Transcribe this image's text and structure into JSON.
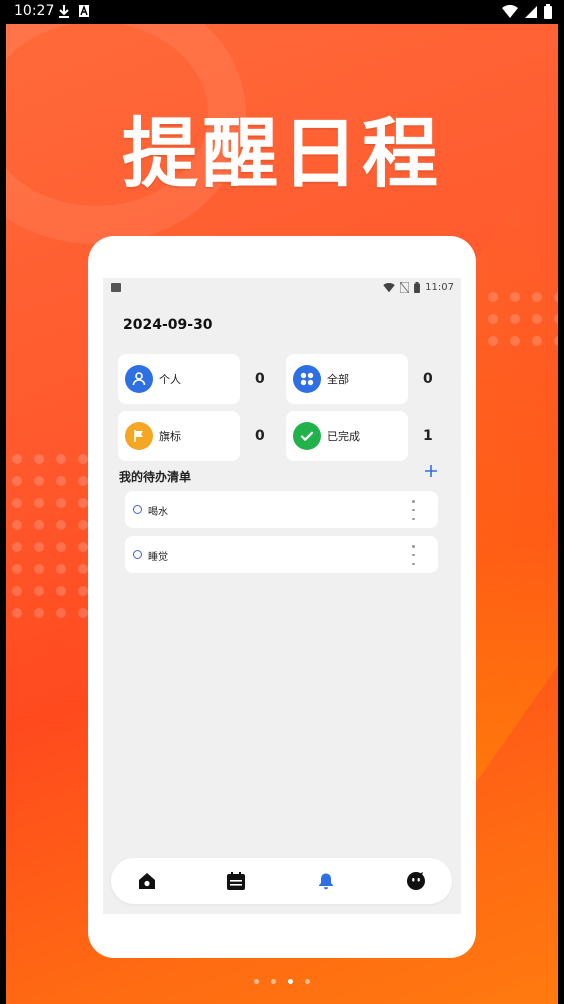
{
  "statusbar": {
    "time": "10:27",
    "icons": [
      "download-icon",
      "a-badge-icon",
      "wifi-icon",
      "signal-icon",
      "battery-icon"
    ]
  },
  "poster": {
    "headline": "提醒日程"
  },
  "inner_statusbar": {
    "time": "11:07",
    "icons": [
      "image-icon",
      "wifi-icon",
      "no-sim-icon",
      "battery-icon"
    ]
  },
  "app": {
    "date": "2024-09-30",
    "cards": [
      {
        "label": "个人",
        "count": "0",
        "icon": "person-icon",
        "color": "#2f6fe4"
      },
      {
        "label": "全部",
        "count": "0",
        "icon": "grid-icon",
        "color": "#2f6fe4"
      },
      {
        "label": "旗标",
        "count": "0",
        "icon": "flag-icon",
        "color": "#f5a623"
      },
      {
        "label": "已完成",
        "count": "1",
        "icon": "check-icon",
        "color": "#22b24c"
      }
    ],
    "list_title": "我的待办清单",
    "todos": [
      {
        "text": "喝水"
      },
      {
        "text": "睡觉"
      }
    ],
    "tabs": [
      {
        "name": "home-icon",
        "active": false
      },
      {
        "name": "calendar-icon",
        "active": false
      },
      {
        "name": "bell-icon",
        "active": true
      },
      {
        "name": "profile-icon",
        "active": false
      }
    ]
  },
  "pager": {
    "count": 4,
    "active_index": 2
  },
  "colors": {
    "accent": "#2f6fe4",
    "poster_orange": "#ff5a2e"
  }
}
